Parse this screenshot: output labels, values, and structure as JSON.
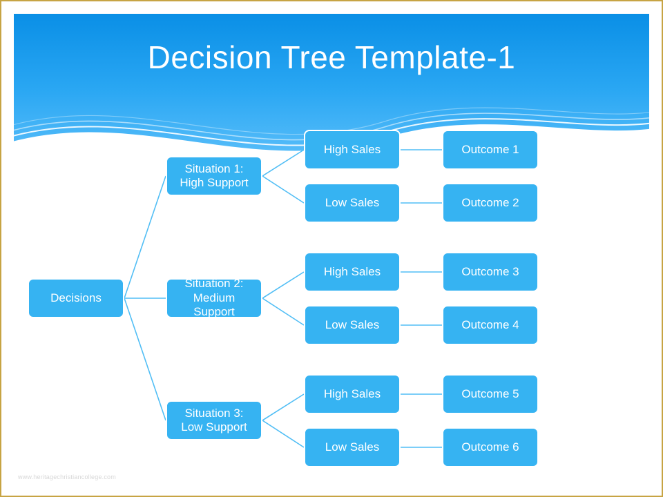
{
  "title": "Decision Tree Template-1",
  "watermark": "www.heritagechristiancollege.com",
  "tree": {
    "root": "Decisions",
    "situations": [
      {
        "label": "Situation 1: High Support",
        "leaves": [
          {
            "sales": "High Sales",
            "outcome": "Outcome 1"
          },
          {
            "sales": "Low Sales",
            "outcome": "Outcome 2"
          }
        ]
      },
      {
        "label": "Situation 2: Medium Support",
        "leaves": [
          {
            "sales": "High Sales",
            "outcome": "Outcome 3"
          },
          {
            "sales": "Low Sales",
            "outcome": "Outcome 4"
          }
        ]
      },
      {
        "label": "Situation 3: Low Support",
        "leaves": [
          {
            "sales": "High Sales",
            "outcome": "Outcome 5"
          },
          {
            "sales": "Low Sales",
            "outcome": "Outcome 6"
          }
        ]
      }
    ]
  },
  "colors": {
    "box": "#36b3f2",
    "boxBorder": "#ffffff",
    "gradTop": "#0a8fe6",
    "gradBot": "#63c3fb",
    "frame": "#c7a443"
  }
}
